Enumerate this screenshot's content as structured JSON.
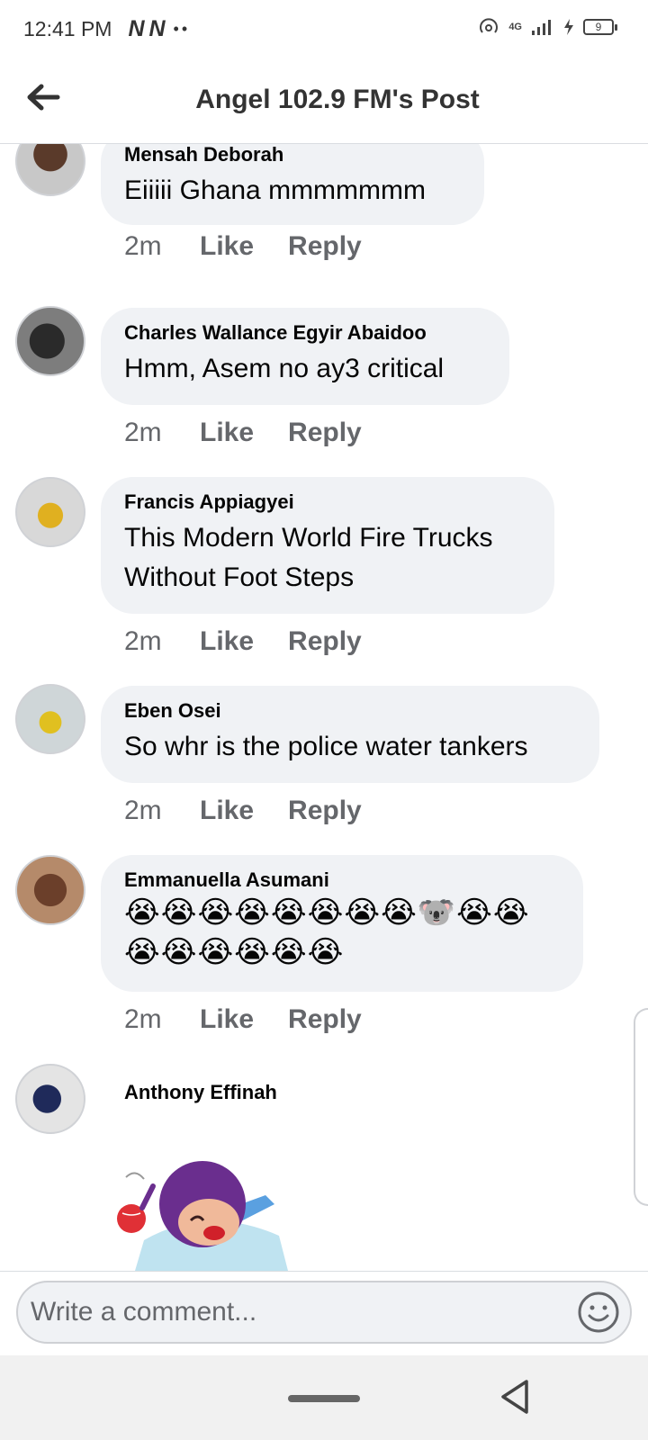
{
  "status_bar": {
    "time": "12:41 PM",
    "carrier_icons": "N N",
    "dots": "••",
    "network": "4G",
    "battery": "9"
  },
  "header": {
    "title": "Angel 102.9 FM's Post",
    "back_icon": "back-arrow-icon"
  },
  "comments": [
    {
      "author": "Mensah Deborah",
      "lines": [
        "Eiiiii Ghana mmmmmmm"
      ],
      "time": "2m",
      "like": "Like",
      "reply": "Reply"
    },
    {
      "author": "Charles Wallance Egyir Abaidoo",
      "lines": [
        "Hmm, Asem no ay3 critical"
      ],
      "time": "2m",
      "like": "Like",
      "reply": "Reply"
    },
    {
      "author": "Francis Appiagyei",
      "lines": [
        "This Modern World Fire Trucks",
        "Without Foot Steps"
      ],
      "time": "2m",
      "like": "Like",
      "reply": "Reply"
    },
    {
      "author": "Eben Osei",
      "lines": [
        "So whr is the police water tankers"
      ],
      "time": "2m",
      "like": "Like",
      "reply": "Reply"
    },
    {
      "author": "Emmanuella Asumani",
      "lines": [
        "😭😭😭😭😭😭😭😭🐨😭😭",
        "😭😭😭😭😭😭"
      ],
      "time": "2m",
      "like": "Like",
      "reply": "Reply"
    },
    {
      "author": "Anthony Effinah"
    }
  ],
  "composer": {
    "placeholder": "Write a comment...",
    "emoji_icon": "smiley-icon"
  },
  "colors": {
    "bubble": "#f0f2f5",
    "meta_text": "#65676b",
    "text": "#050505"
  }
}
